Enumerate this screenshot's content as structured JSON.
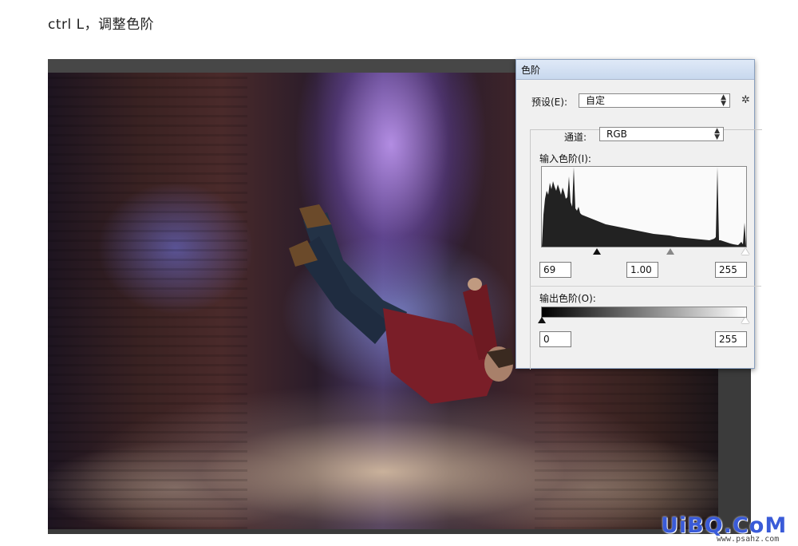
{
  "instruction": "ctrl  L，调整色阶",
  "dialog": {
    "title": "色阶",
    "preset_label": "预设(E):",
    "preset_value": "自定",
    "channel_label": "通道:",
    "channel_value": "RGB",
    "input_levels_label": "输入色阶(I):",
    "input_black": "69",
    "input_gamma": "1.00",
    "input_white": "255",
    "output_levels_label": "输出色阶(O):",
    "output_black": "0",
    "output_white": "255"
  },
  "watermark": {
    "logo": "UiBQ.CoM",
    "url": "www.psahz.com"
  },
  "icons": {
    "gear": "gear-icon",
    "select_arrows": "updown-arrows-icon"
  }
}
